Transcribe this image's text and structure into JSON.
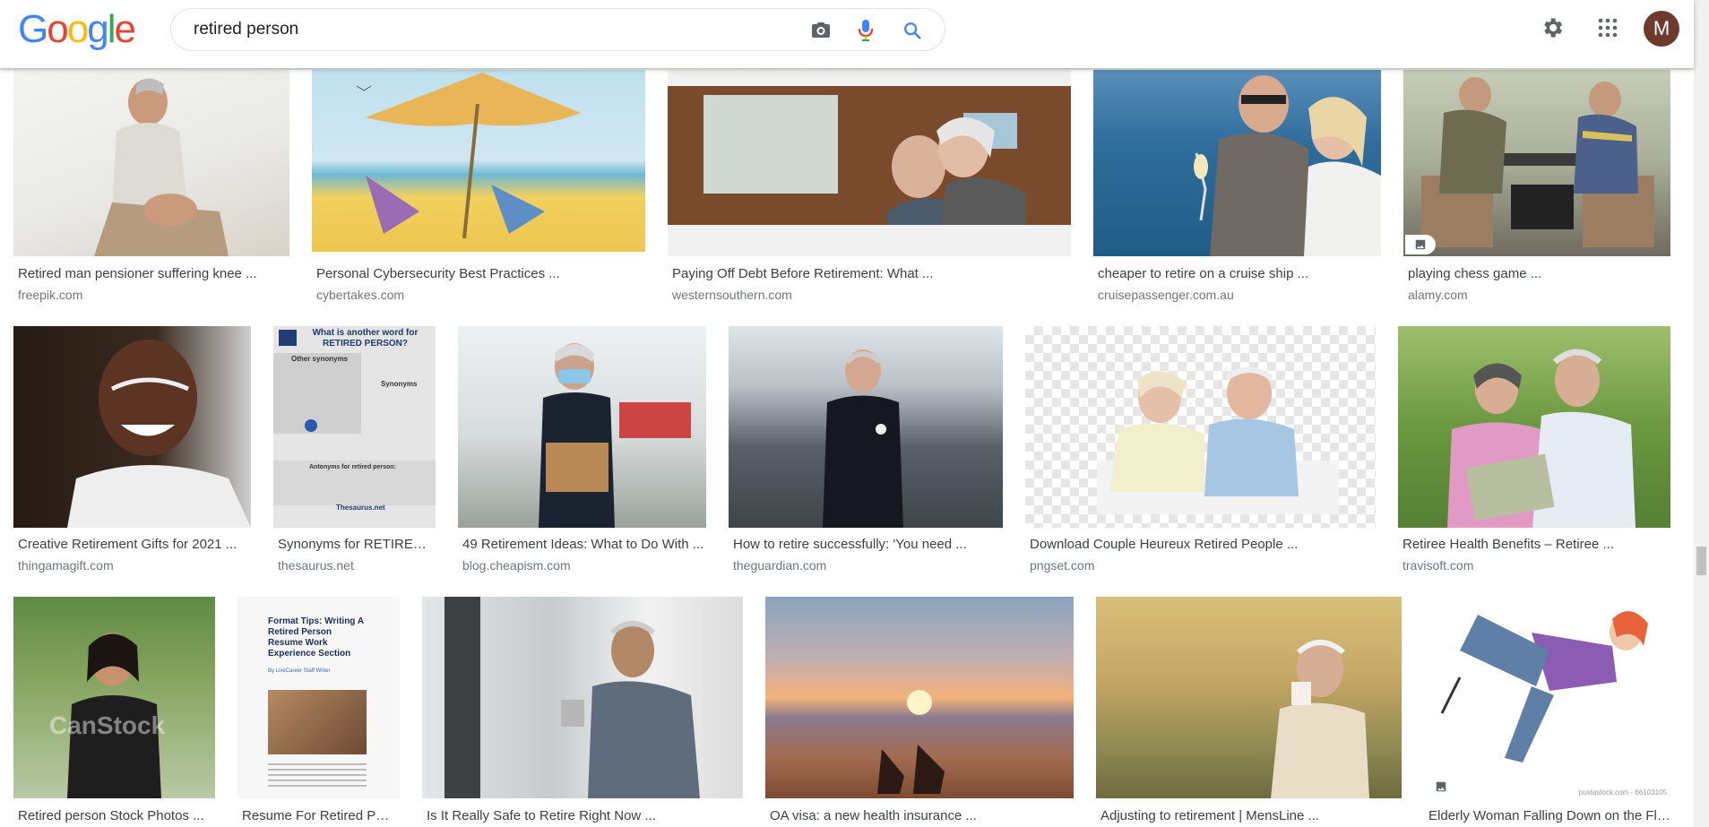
{
  "logo": [
    "G",
    "o",
    "o",
    "g",
    "l",
    "e"
  ],
  "search": {
    "value": "retired person"
  },
  "avatar": {
    "initial": "M"
  },
  "colors": {
    "blue": "#4285f4",
    "red": "#ea4335",
    "yellow": "#fbbc05",
    "green": "#34a853",
    "title": "#3c4043",
    "source": "#70757a"
  },
  "header_icons": [
    "camera-icon",
    "microphone-icon",
    "search-icon",
    "gear-icon",
    "apps-icon"
  ],
  "results": [
    {
      "title": "Retired man pensioner suffering knee ...",
      "source": "freepik.com"
    },
    {
      "title": "Personal Cybersecurity Best Practices ...",
      "source": "cybertakes.com"
    },
    {
      "title": "Paying Off Debt Before Retirement: What ...",
      "source": "westernsouthern.com"
    },
    {
      "title": "cheaper to retire on a cruise ship ...",
      "source": "cruisepassenger.com.au"
    },
    {
      "title": "playing chess game ...",
      "source": "alamy.com"
    },
    {
      "title": "Creative Retirement Gifts for 2021 ...",
      "source": "thingamagift.com"
    },
    {
      "title": "Synonyms for RETIRED PERSON ...",
      "source": "thesaurus.net"
    },
    {
      "title": "49 Retirement Ideas: What to Do With ...",
      "source": "blog.cheapism.com"
    },
    {
      "title": "How to retire successfully: 'You need ...",
      "source": "theguardian.com"
    },
    {
      "title": "Download Couple Heureux Retired People ...",
      "source": "pngset.com"
    },
    {
      "title": "Retiree Health Benefits – Retiree ...",
      "source": "travisoft.com"
    },
    {
      "title": "Retired person Stock Photos ...",
      "source": ""
    },
    {
      "title": "Resume For Retired Person ...",
      "source": ""
    },
    {
      "title": "Is It Really Safe to Retire Right Now ...",
      "source": ""
    },
    {
      "title": "OA visa: a new health insurance ...",
      "source": ""
    },
    {
      "title": "Adjusting to retirement | MensLine ...",
      "source": ""
    },
    {
      "title": "Elderly Woman Falling Down on the Floor ...",
      "source": ""
    }
  ],
  "thumb_text": {
    "thesaurus_heading": "What is another word for RETIRED PERSON?",
    "thesaurus_other": "Other synonyms",
    "thesaurus_syn": "Synonyms",
    "thesaurus_ant": "Antonyms for retired person:",
    "thesaurus_brand": "Thesaurus.net",
    "resume_heading": "Format Tips: Writing A Retired Person Resume Work Experience Section",
    "resume_by": "By LiveCareer Staff Writer",
    "canstock": "CanStock",
    "postastock": "postastock.com - 66103105"
  }
}
